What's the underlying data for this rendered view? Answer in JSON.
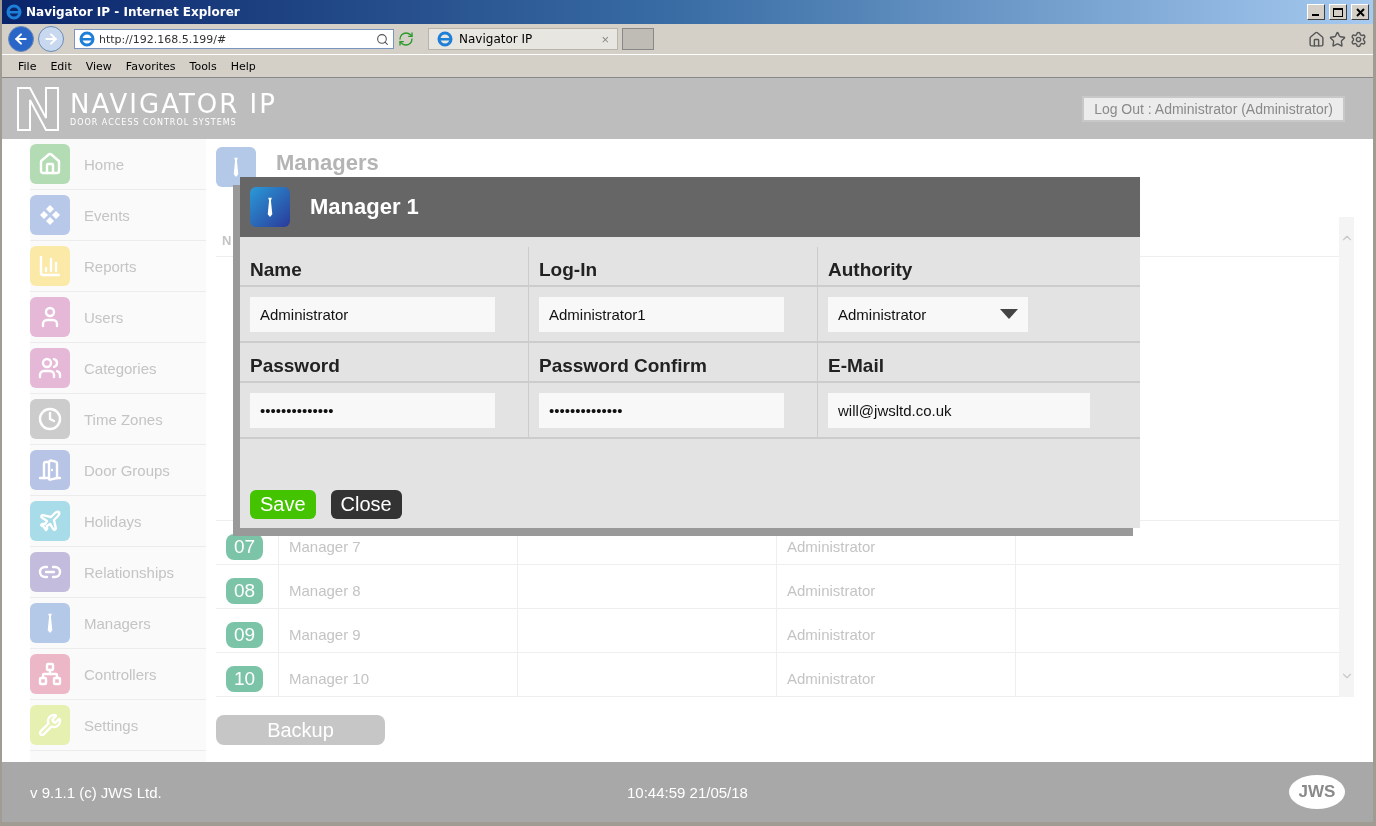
{
  "browser": {
    "title": "Navigator IP - Internet Explorer",
    "address": "http://192.168.5.199/#",
    "tab_title": "Navigator IP",
    "tab_close": "×",
    "menu": [
      "File",
      "Edit",
      "View",
      "Favorites",
      "Tools",
      "Help"
    ]
  },
  "header": {
    "logo_name": "NAVIGATOR IP",
    "logo_tagline": "DOOR ACCESS CONTROL SYSTEMS",
    "logout": "Log Out : Administrator (Administrator)"
  },
  "sidebar": [
    {
      "label": "Home",
      "color": "#b4dcb4"
    },
    {
      "label": "Events",
      "color": "#b8c8e8"
    },
    {
      "label": "Reports",
      "color": "#fbe9a8"
    },
    {
      "label": "Users",
      "color": "#e6b8d8"
    },
    {
      "label": "Categories",
      "color": "#e6b8d8"
    },
    {
      "label": "Time Zones",
      "color": "#cccccc"
    },
    {
      "label": "Door Groups",
      "color": "#b8c4e6"
    },
    {
      "label": "Holidays",
      "color": "#a8dce8"
    },
    {
      "label": "Relationships",
      "color": "#c4bcdc"
    },
    {
      "label": "Managers",
      "color": "#b4c8e8"
    },
    {
      "label": "Controllers",
      "color": "#ecb8c8"
    },
    {
      "label": "Settings",
      "color": "#e6f0b0"
    }
  ],
  "page": {
    "title": "Managers",
    "table": {
      "columns": [
        "N"
      ],
      "rows": [
        {
          "number": "07",
          "name": "Manager 7",
          "authority": "Administrator"
        },
        {
          "number": "08",
          "name": "Manager 8",
          "authority": "Administrator"
        },
        {
          "number": "09",
          "name": "Manager 9",
          "authority": "Administrator"
        },
        {
          "number": "10",
          "name": "Manager 10",
          "authority": "Administrator"
        }
      ]
    },
    "backup": "Backup"
  },
  "dialog": {
    "title": "Manager 1",
    "fields": [
      {
        "label": "Name",
        "value": "Administrator",
        "kind": "text"
      },
      {
        "label": "Log-In",
        "value": "Administrator1",
        "kind": "text"
      },
      {
        "label": "Authority",
        "value": "Administrator",
        "kind": "select"
      },
      {
        "label": "Password",
        "value": "••••••••••••••",
        "kind": "password"
      },
      {
        "label": "Password Confirm",
        "value": "••••••••••••••",
        "kind": "password"
      },
      {
        "label": "E-Mail",
        "value": "will@jwsltd.co.uk",
        "kind": "email"
      }
    ],
    "buttons": [
      {
        "label": "Save",
        "kind": "save"
      },
      {
        "label": "Close",
        "kind": "close"
      }
    ]
  },
  "footer": {
    "version": "v 9.1.1 (c) JWS Ltd.",
    "datetime": "10:44:59 21/05/18",
    "logo": "JWS"
  }
}
